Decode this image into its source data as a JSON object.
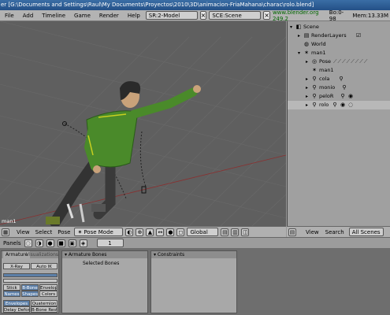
{
  "window": {
    "title": "er [G:\\Documents and Settings\\Raul\\My Documents\\Proyectos\\2010\\3D\\animacion-FriaMahana\\charac\\rolo.blend]"
  },
  "menubar": {
    "items": [
      "File",
      "Add",
      "Timeline",
      "Game",
      "Render",
      "Help"
    ],
    "screen": "SR:2-Model",
    "scene": "SCE:Scene",
    "url": "www.blender.org 249.2",
    "stats": "Bo:0-98",
    "mem": "Mem:13.33M"
  },
  "viewport": {
    "object_label": "man1"
  },
  "outliner": {
    "rows": [
      {
        "label": "Scene",
        "icon": "scene-icon",
        "depth": 0,
        "expanded": true
      },
      {
        "label": "RenderLayers",
        "icon": "render-layers-icon",
        "depth": 1,
        "expanded": false
      },
      {
        "label": "World",
        "icon": "world-icon",
        "depth": 1,
        "expanded": false
      },
      {
        "label": "man1",
        "icon": "armature-icon",
        "depth": 1,
        "expanded": true
      },
      {
        "label": "Pose",
        "icon": "pose-icon",
        "depth": 2,
        "expanded": false
      },
      {
        "label": "man1",
        "icon": "armature-data-icon",
        "depth": 2,
        "expanded": false
      },
      {
        "label": "cola",
        "icon": "mesh-icon",
        "depth": 2,
        "expanded": false
      },
      {
        "label": "monio",
        "icon": "mesh-icon",
        "depth": 2,
        "expanded": false
      },
      {
        "label": "peloR",
        "icon": "mesh-icon",
        "depth": 2,
        "expanded": false
      },
      {
        "label": "rolo",
        "icon": "mesh-icon",
        "depth": 2,
        "expanded": false,
        "selected": true
      }
    ]
  },
  "viewport_header": {
    "items": [
      "View",
      "Select",
      "Pose"
    ],
    "mode": "Pose Mode",
    "orientation": "Global"
  },
  "outliner_header": {
    "view": "View",
    "search": "Search",
    "filter": "All Scenes"
  },
  "panels_bar": {
    "label": "Panels",
    "frame": "1"
  },
  "panels": {
    "armature": {
      "tab_active": "Armature",
      "tab_other": "Visualizations",
      "buttons": {
        "xray": "X-Ray",
        "auto_ik": "Auto IK",
        "stick": "Stick",
        "bbone": "B-Bone",
        "envelope": "Envelope",
        "names": "Names",
        "shapes": "Shapes",
        "colors": "Colors",
        "envelopes": "Envelopes",
        "quaternion": "Quaternion",
        "deform": "Delay Deform",
        "bbone_rest": "B-Bone Rest"
      }
    },
    "armature_bones": {
      "title": "Armature Bones",
      "selected_bones": "Selected Bones"
    },
    "constraints": {
      "title": "Constraints"
    }
  },
  "colors": {
    "viewport_bg": "#5f5f5f",
    "character_shirt": "#4a8a2a",
    "character_pants": "#3a3a3a",
    "selection_blue": "#5c7fa8"
  }
}
